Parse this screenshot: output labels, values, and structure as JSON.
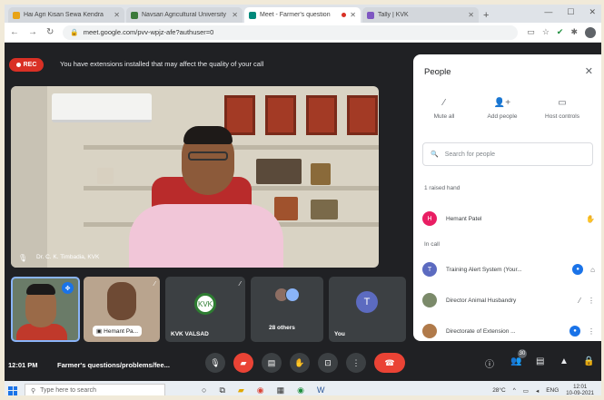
{
  "browser": {
    "tabs": [
      {
        "label": "Hai Agri Kisan Sewa Kendra",
        "favicon_color": "#e8a317",
        "active": false
      },
      {
        "label": "Navsari Agricultural University",
        "favicon_color": "#3b7a3b",
        "active": false
      },
      {
        "label": "Meet - Farmer's question",
        "favicon_color": "#00897b",
        "active": true,
        "recording": true
      },
      {
        "label": "Tally | KVK",
        "favicon_color": "#7e57c2",
        "active": false
      }
    ],
    "new_tab_icon": "plus-icon",
    "window_controls": [
      "minimize-icon",
      "maximize-icon",
      "close-icon"
    ],
    "url": "meet.google.com/pvv-wpjz-afe?authuser=0",
    "nav_icons": [
      "back-arrow-icon",
      "forward-arrow-icon",
      "reload-icon"
    ]
  },
  "meet": {
    "rec_label": "REC",
    "warning": "You have extensions installed that may affect the quality of your call",
    "main_speaker_name": "Dr. C. K. Timbadia, KVK",
    "time": "12:01 PM",
    "meeting_title": "Farmer's questions/problems/fee...",
    "tiles": [
      {
        "name": "",
        "pinned": true
      },
      {
        "name": "Hemant Pa..."
      },
      {
        "name": "KVK VALSAD",
        "logo_text": "KVK"
      },
      {
        "name": "28 others"
      },
      {
        "name": "You",
        "avatar_letter": "T"
      }
    ],
    "participant_count": "30",
    "controls": [
      "mic-icon",
      "camera-off-icon",
      "captions-icon",
      "raise-hand-icon",
      "present-icon",
      "more-icon",
      "end-call-icon"
    ],
    "right_controls": [
      "info-icon",
      "people-icon",
      "chat-icon",
      "activities-icon",
      "lock-icon"
    ]
  },
  "people": {
    "title": "People",
    "actions": [
      {
        "label": "Mute all",
        "icon": "mic-off-icon"
      },
      {
        "label": "Add people",
        "icon": "add-person-icon"
      },
      {
        "label": "Host controls",
        "icon": "host-controls-icon"
      }
    ],
    "search_placeholder": "Search for people",
    "raised_hand_header": "1 raised hand",
    "raised": [
      {
        "name": "Hemant Patel",
        "initial": "H",
        "color": "#e91e63"
      }
    ],
    "in_call_header": "In call",
    "in_call": [
      {
        "name": "Training Alert System (Your...",
        "initial": "T",
        "color": "#5c6bc0"
      },
      {
        "name": "Director Animal Husbandry",
        "initial": "",
        "color": "#7b8a6a"
      },
      {
        "name": "Directorate of Extension ...",
        "initial": "",
        "color": "#b07a4a"
      }
    ]
  },
  "taskbar": {
    "search_placeholder": "Type here to search",
    "weather": "28°C",
    "language": "ENG",
    "time": "12:01",
    "date": "10-09-2021"
  }
}
